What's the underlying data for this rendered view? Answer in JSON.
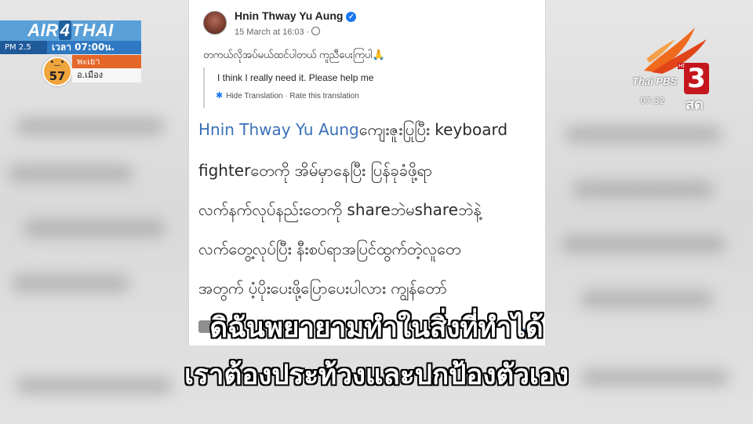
{
  "air4thai": {
    "brand_left": "AIR",
    "brand_four": "4",
    "brand_right": "THAI",
    "pm_label": "PM 2.5",
    "time_label": "เวลา 07:00น.",
    "aqi_value": "57",
    "province": "พะเยา",
    "district": "อ.เมือง",
    "aqi_color": "#f0a43c"
  },
  "broadcaster": {
    "name": "Thai PBS",
    "channel": "3",
    "hd_label": "HD",
    "clock": "07:32",
    "live_label": "สด",
    "accent_color": "#c4161c"
  },
  "post": {
    "author": "Hnin Thway Yu Aung",
    "verified_icon": "check",
    "timestamp": "15 March at 16:03 ·",
    "text": "တကယ်လိုအပ်မယ်ထင်ပါတယ် ကူညီပေးကြပါ",
    "emoji": "🙏",
    "translation": "I think I really need it. Please help me",
    "hide_translation": "Hide Translation",
    "separator": "·",
    "rate_translation": "Rate this translation"
  },
  "comment": {
    "name": "Hnin Thway Yu Aung",
    "line1_rest": "ကျေးဇူးပြုပြီး  keyboard",
    "line2": "fighterတေကို အိမ်မှာနေပြီး ပြန်ခုခံဖို့ရာ",
    "line3": "လက်နက်လုပ်နည်းတေကို shareဘဲမshareဘဲနဲ့",
    "line4": "လက်တွေ့လုပ်ပြီး  နီးစပ်ရာအပြင်ထွက်တဲ့လူတေ",
    "line5": "အတွက်  ပံ့ပိုးပေးဖို့ပြောပေးပါလား   ကျွန်တော်"
  },
  "subtitles": {
    "line1": "ดิฉันพยายามทำในสิ่งที่ทำได้",
    "line2": "เราต้องประท้วงและปกป้องตัวเอง"
  }
}
